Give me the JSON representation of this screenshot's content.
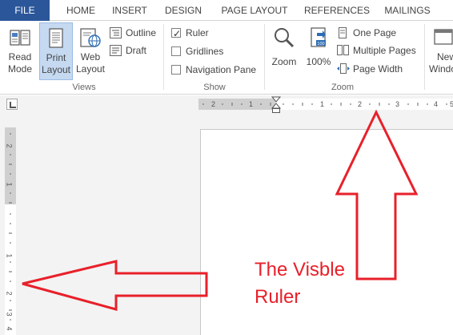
{
  "tabs": [
    "FILE",
    "HOME",
    "INSERT",
    "DESIGN",
    "PAGE LAYOUT",
    "REFERENCES",
    "MAILINGS"
  ],
  "views_group": {
    "label": "Views",
    "read_mode": [
      "Read",
      "Mode"
    ],
    "print_layout": [
      "Print",
      "Layout"
    ],
    "web_layout": [
      "Web",
      "Layout"
    ],
    "outline": "Outline",
    "draft": "Draft"
  },
  "show_group": {
    "label": "Show",
    "ruler": "Ruler",
    "ruler_checked": true,
    "gridlines": "Gridlines",
    "gridlines_checked": false,
    "navigation_pane": "Navigation Pane",
    "navigation_pane_checked": false
  },
  "zoom_group": {
    "label": "Zoom",
    "zoom": "Zoom",
    "percent": "100%",
    "one_page": "One Page",
    "multiple_pages": "Multiple Pages",
    "page_width": "Page Width"
  },
  "window_group": {
    "new_window": [
      "New",
      "Window"
    ]
  },
  "hruler_numbers": [
    "2",
    "1",
    "1",
    "2",
    "3",
    "4",
    "5"
  ],
  "vruler_numbers": [
    "2",
    "1",
    "1",
    "2",
    "3",
    "4"
  ],
  "annotation": [
    "The Visble",
    "Ruler"
  ],
  "colors": {
    "file_tab": "#2b579a",
    "annotation": "#e8202a",
    "active_view": "#c5d9f1"
  }
}
